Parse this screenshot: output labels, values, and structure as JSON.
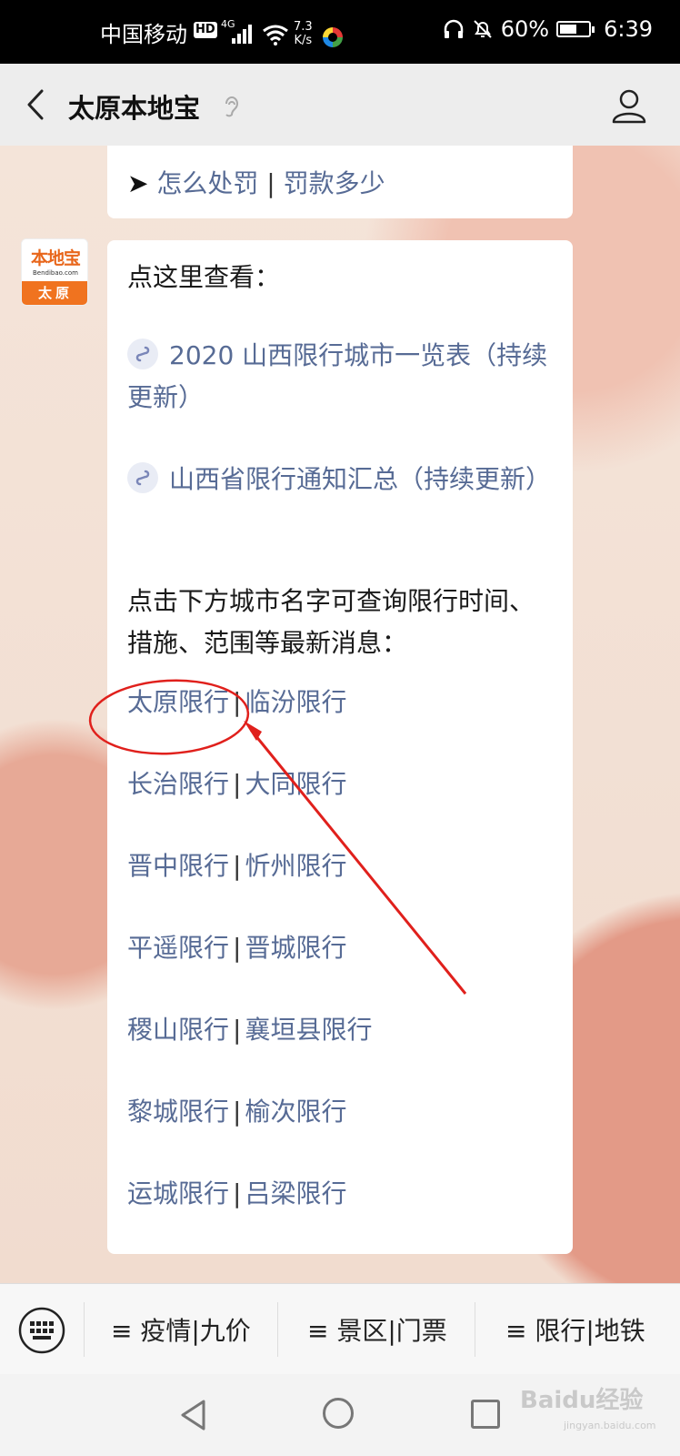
{
  "status_bar": {
    "carrier": "中国移动",
    "hd": "HD",
    "network": "4G",
    "speed_value": "7.3",
    "speed_unit": "K/s",
    "battery": "60%",
    "time": "6:39",
    "signal_bars": 4,
    "battery_level": 0.6
  },
  "header": {
    "title": "太原本地宝"
  },
  "messages": {
    "first": {
      "arrow": "➤",
      "part1": "怎么处罚",
      "sep": "|",
      "part2": "罚款多少"
    },
    "avatar": {
      "logo": "本地宝",
      "sub": "Bendibao.com",
      "city": "太原"
    },
    "second": {
      "intro": "点这里查看：",
      "link1": "2020 山西限行城市一览表（持续更新）",
      "link2": "山西省限行通知汇总（持续更新）",
      "city_intro": "点击下方城市名字可查询限行时间、措施、范围等最新消息：",
      "sep": "|",
      "city_rows": [
        [
          "太原限行",
          "临汾限行"
        ],
        [
          "长治限行",
          "大同限行"
        ],
        [
          "晋中限行",
          "忻州限行"
        ],
        [
          "平遥限行",
          "晋城限行"
        ],
        [
          "稷山限行",
          "襄垣县限行"
        ],
        [
          "黎城限行",
          "榆次限行"
        ],
        [
          "运城限行",
          "吕梁限行"
        ]
      ]
    }
  },
  "bottom_menu": {
    "items": [
      "≡ 疫情|九价",
      "≡ 景区|门票",
      "≡ 限行|地铁"
    ]
  },
  "watermark": {
    "main": "Baidu经验",
    "sub": "jingyan.baidu.com"
  },
  "colors": {
    "link": "#576b95",
    "annotation": "#e0201c",
    "brand": "#f0731f"
  }
}
